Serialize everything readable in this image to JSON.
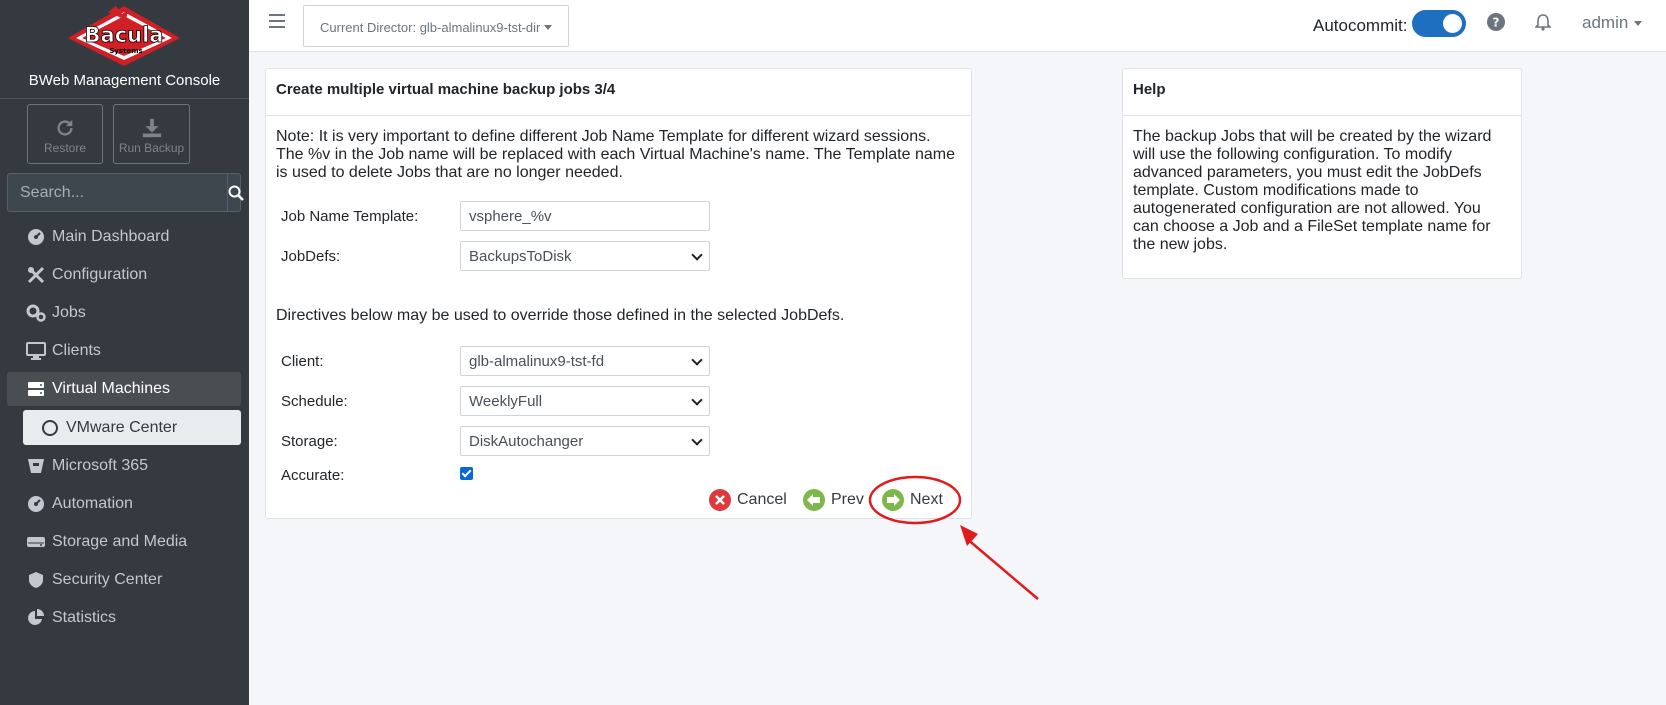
{
  "brand": {
    "logo_text": "Bacula",
    "logo_sub": "Systems",
    "title": "BWeb Management Console"
  },
  "actions": {
    "restore": "Restore",
    "run_backup": "Run Backup"
  },
  "search": {
    "placeholder": "Search..."
  },
  "sidebar": {
    "items": [
      {
        "label": "Main Dashboard",
        "icon": "dashboard-icon"
      },
      {
        "label": "Configuration",
        "icon": "tools-icon"
      },
      {
        "label": "Jobs",
        "icon": "gears-icon"
      },
      {
        "label": "Clients",
        "icon": "desktop-icon"
      },
      {
        "label": "Virtual Machines",
        "icon": "server-icon",
        "active": true
      },
      {
        "label": "Microsoft 365",
        "icon": "bucket-icon"
      },
      {
        "label": "Automation",
        "icon": "dashboard-icon"
      },
      {
        "label": "Storage and Media",
        "icon": "hdd-icon"
      },
      {
        "label": "Security Center",
        "icon": "shield-icon"
      },
      {
        "label": "Statistics",
        "icon": "pie-chart-icon"
      }
    ],
    "sub_item": "VMware Center"
  },
  "topbar": {
    "director": "Current Director: glb-almalinux9-tst-dir",
    "autocommit_label": "Autocommit:",
    "user": "admin"
  },
  "wizard": {
    "title": "Create multiple virtual machine backup jobs 3/4",
    "note": "Note: It is very important to define different Job Name Template for different wizard sessions. The %v in the Job name will be replaced with each Virtual Machine's name. The Template name is used to delete Jobs that are no longer needed.",
    "job_name_label": "Job Name Template:",
    "job_name_value": "vsphere_%v",
    "jobdefs_label": "JobDefs:",
    "jobdefs_value": "BackupsToDisk",
    "directives_text": "Directives below may be used to override those defined in the selected JobDefs.",
    "client_label": "Client:",
    "client_value": "glb-almalinux9-tst-fd",
    "schedule_label": "Schedule:",
    "schedule_value": "WeeklyFull",
    "storage_label": "Storage:",
    "storage_value": "DiskAutochanger",
    "accurate_label": "Accurate:",
    "accurate_checked": true,
    "cancel": "Cancel",
    "prev": "Prev",
    "next": "Next"
  },
  "help": {
    "title": "Help",
    "text": "The backup Jobs that will be created by the wizard will use the following configuration. To modify advanced parameters, you must edit the JobDefs template. Custom modifications made to autogenerated configuration are not allowed. You can choose a Job and a FileSet template name for the new jobs."
  },
  "colors": {
    "sidebar_bg": "#343a40",
    "toggle": "#1e6fc0",
    "cancel_red": "#e0393c",
    "nav_green": "#7cb84a",
    "annotation_red": "#e01b1b"
  }
}
